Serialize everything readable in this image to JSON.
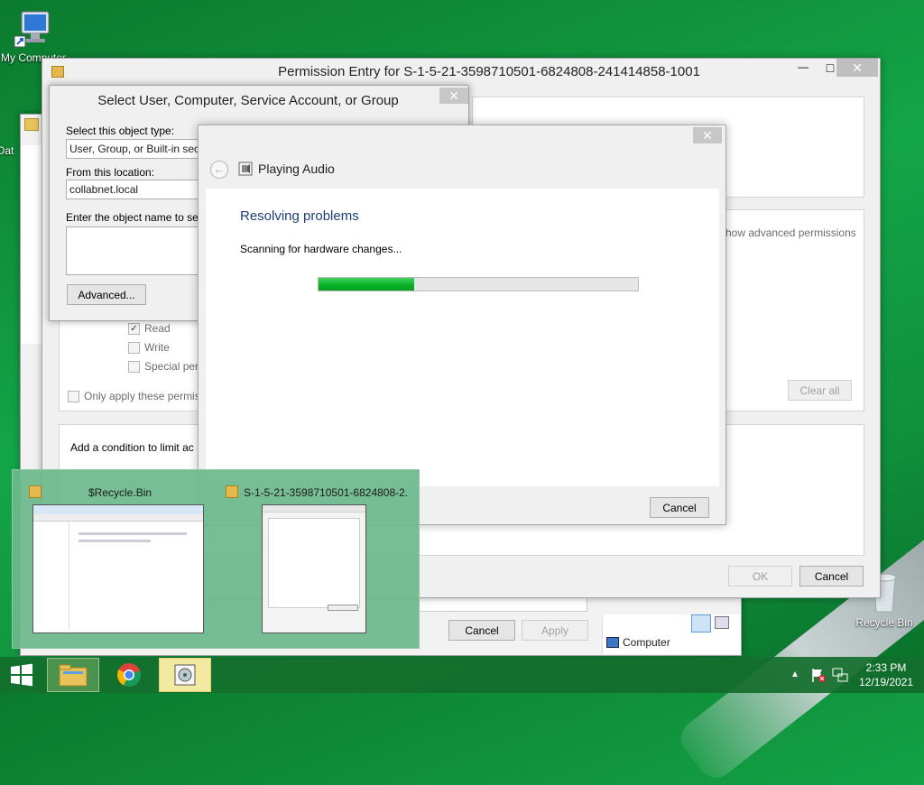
{
  "desktop": {
    "icons": [
      {
        "label": "My Computer"
      },
      {
        "label": "Dat"
      },
      {
        "label": "Recycle Bin"
      }
    ]
  },
  "permission_entry": {
    "title": "Permission Entry for S-1-5-21-3598710501-6824808-241414858-1001",
    "minimize_label": "—",
    "maximize_label": "□",
    "close_label": "✕",
    "show_advanced_link": "how advanced permissions",
    "permissions": [
      {
        "label": "Read",
        "checked": true
      },
      {
        "label": "Write",
        "checked": false
      },
      {
        "label": "Special perm",
        "checked": false
      }
    ],
    "only_apply_label": "Only apply these permiss",
    "clear_all_label": "Clear all",
    "condition_text": "Add a condition to limit ac",
    "ok_label": "OK",
    "cancel_label": "Cancel"
  },
  "background_dialog": {
    "cancel_label": "Cancel",
    "apply_label": "Apply",
    "computer_label": "Computer"
  },
  "select_user": {
    "title": "Select User, Computer, Service Account, or Group",
    "object_type_label": "Select this object type:",
    "object_type_value": "User, Group, or Built-in security",
    "location_label": "From this location:",
    "location_value": "collabnet.local",
    "enter_label": "Enter the object name to select",
    "enter_value": "",
    "advanced_label": "Advanced..."
  },
  "troubleshooter": {
    "close_label": "✕",
    "header": "Playing Audio",
    "heading": "Resolving problems",
    "status": "Scanning for hardware changes...",
    "progress": 0.3,
    "cancel_label": "Cancel"
  },
  "thumbnails": [
    {
      "title": "$Recycle.Bin"
    },
    {
      "title": "S-1-5-21-3598710501-6824808-2..."
    }
  ],
  "taskbar": {
    "time": "2:33 PM",
    "date": "12/19/2021"
  },
  "colors": {
    "accent_green": "#06b025",
    "heading_blue": "#1e3d7b"
  }
}
